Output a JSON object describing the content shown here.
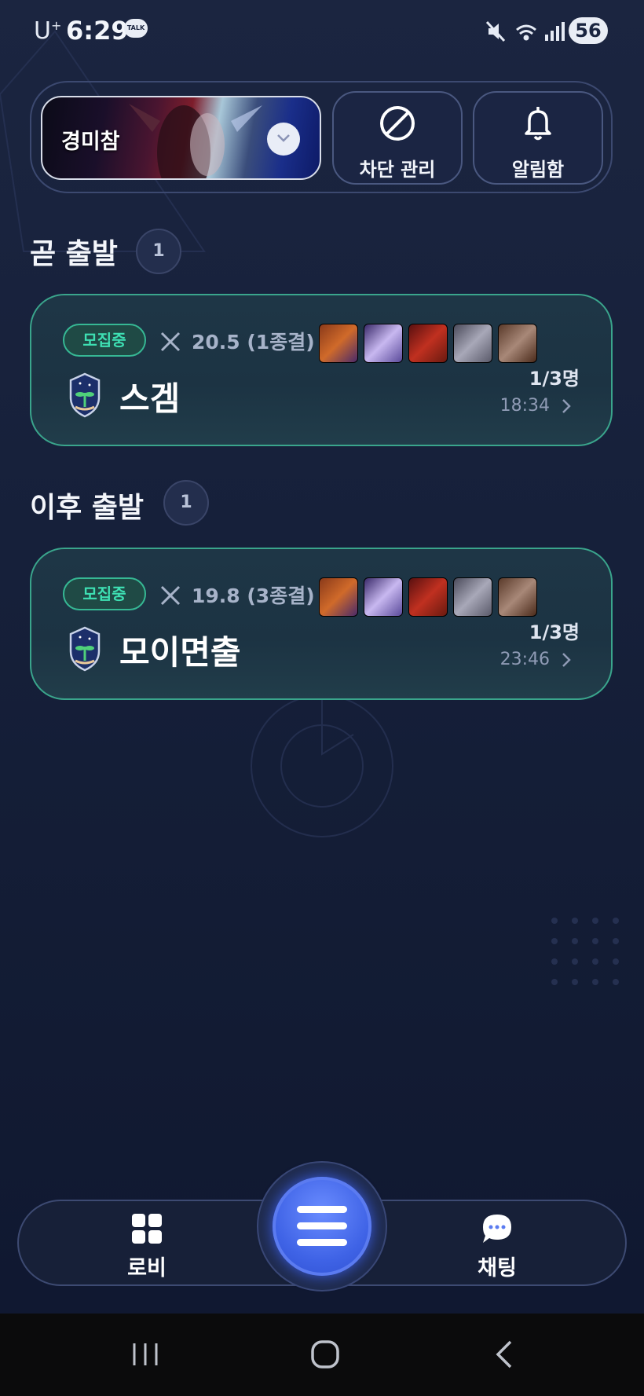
{
  "status_bar": {
    "carrier": "U",
    "carrier_sup": "+",
    "time": "6:29",
    "talk_icon_label": "TALK",
    "battery": "56"
  },
  "header": {
    "profile_name": "경미참",
    "block_label": "차단 관리",
    "notifications_label": "알림함"
  },
  "sections": [
    {
      "title": "곧 출발",
      "count": "1",
      "cards": [
        {
          "status": "모집중",
          "score": "20.5 (1종결)",
          "name": "스겜",
          "members": "1/3명",
          "time": "18:34"
        }
      ]
    },
    {
      "title": "이후 출발",
      "count": "1",
      "cards": [
        {
          "status": "모집중",
          "score": "19.8 (3종결)",
          "name": "모이면출",
          "members": "1/3명",
          "time": "23:46"
        }
      ]
    }
  ],
  "bottom_nav": {
    "lobby_label": "로비",
    "chat_label": "채팅"
  },
  "colors": {
    "accent_green": "#3ee0b3",
    "card_border": "#3aa58c",
    "fab_blue": "#3f63e6"
  }
}
